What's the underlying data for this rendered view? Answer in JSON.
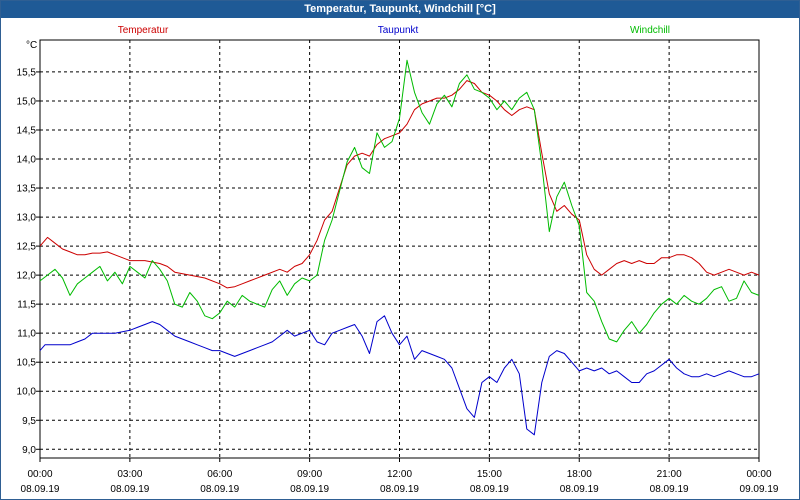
{
  "window": {
    "title": "Temperatur, Taupunkt, Windchill [°C]"
  },
  "chart_data": {
    "type": "line",
    "title": "Temperatur, Taupunkt, Windchill [°C]",
    "ylabel": "°C",
    "ylim": [
      8.85,
      16.05
    ],
    "xlim": [
      "08.09.19 00:00",
      "09.09.19 00:00"
    ],
    "grid": true,
    "legend_position": "top",
    "y_ticks": [
      "9,0",
      "9,5",
      "10,0",
      "10,5",
      "11,0",
      "11,5",
      "12,0",
      "12,5",
      "13,0",
      "13,5",
      "14,0",
      "14,5",
      "15,0",
      "15,5"
    ],
    "x_ticks": [
      {
        "time": "00:00",
        "date": "08.09.19"
      },
      {
        "time": "03:00",
        "date": "08.09.19"
      },
      {
        "time": "06:00",
        "date": "08.09.19"
      },
      {
        "time": "09:00",
        "date": "08.09.19"
      },
      {
        "time": "12:00",
        "date": "08.09.19"
      },
      {
        "time": "15:00",
        "date": "08.09.19"
      },
      {
        "time": "18:00",
        "date": "08.09.19"
      },
      {
        "time": "21:00",
        "date": "08.09.19"
      },
      {
        "time": "00:00",
        "date": "09.09.19"
      }
    ],
    "series": [
      {
        "name": "Temperatur",
        "color": "#cc0000",
        "points": [
          [
            "00:00",
            12.5
          ],
          [
            "00:15",
            12.65
          ],
          [
            "00:30",
            12.55
          ],
          [
            "00:45",
            12.45
          ],
          [
            "01:00",
            12.4
          ],
          [
            "01:15",
            12.35
          ],
          [
            "01:30",
            12.35
          ],
          [
            "01:45",
            12.38
          ],
          [
            "02:00",
            12.38
          ],
          [
            "02:15",
            12.4
          ],
          [
            "02:30",
            12.35
          ],
          [
            "02:45",
            12.3
          ],
          [
            "03:00",
            12.25
          ],
          [
            "03:30",
            12.25
          ],
          [
            "04:00",
            12.2
          ],
          [
            "04:15",
            12.15
          ],
          [
            "04:30",
            12.05
          ],
          [
            "05:00",
            12.0
          ],
          [
            "05:30",
            11.95
          ],
          [
            "06:00",
            11.85
          ],
          [
            "06:15",
            11.78
          ],
          [
            "06:30",
            11.8
          ],
          [
            "06:45",
            11.85
          ],
          [
            "07:00",
            11.9
          ],
          [
            "07:30",
            12.0
          ],
          [
            "08:00",
            12.1
          ],
          [
            "08:15",
            12.05
          ],
          [
            "08:30",
            12.15
          ],
          [
            "08:45",
            12.2
          ],
          [
            "09:00",
            12.35
          ],
          [
            "09:15",
            12.6
          ],
          [
            "09:30",
            12.95
          ],
          [
            "09:45",
            13.1
          ],
          [
            "10:00",
            13.5
          ],
          [
            "10:15",
            13.9
          ],
          [
            "10:30",
            14.05
          ],
          [
            "10:45",
            14.1
          ],
          [
            "11:00",
            14.05
          ],
          [
            "11:15",
            14.25
          ],
          [
            "11:30",
            14.35
          ],
          [
            "11:45",
            14.4
          ],
          [
            "12:00",
            14.45
          ],
          [
            "12:15",
            14.6
          ],
          [
            "12:30",
            14.85
          ],
          [
            "12:45",
            14.95
          ],
          [
            "13:00",
            15.0
          ],
          [
            "13:15",
            15.05
          ],
          [
            "13:30",
            15.05
          ],
          [
            "13:45",
            15.1
          ],
          [
            "14:00",
            15.2
          ],
          [
            "14:15",
            15.35
          ],
          [
            "14:30",
            15.3
          ],
          [
            "14:45",
            15.15
          ],
          [
            "15:00",
            15.1
          ],
          [
            "15:15",
            15.0
          ],
          [
            "15:30",
            14.85
          ],
          [
            "15:45",
            14.75
          ],
          [
            "16:00",
            14.85
          ],
          [
            "16:15",
            14.9
          ],
          [
            "16:30",
            14.85
          ],
          [
            "16:45",
            14.1
          ],
          [
            "17:00",
            13.4
          ],
          [
            "17:15",
            13.1
          ],
          [
            "17:30",
            13.2
          ],
          [
            "17:45",
            13.05
          ],
          [
            "18:00",
            12.95
          ],
          [
            "18:15",
            12.35
          ],
          [
            "18:30",
            12.1
          ],
          [
            "18:45",
            12.0
          ],
          [
            "19:00",
            12.1
          ],
          [
            "19:15",
            12.2
          ],
          [
            "19:30",
            12.25
          ],
          [
            "19:45",
            12.2
          ],
          [
            "20:00",
            12.25
          ],
          [
            "20:15",
            12.2
          ],
          [
            "20:30",
            12.2
          ],
          [
            "20:45",
            12.3
          ],
          [
            "21:00",
            12.3
          ],
          [
            "21:15",
            12.35
          ],
          [
            "21:30",
            12.35
          ],
          [
            "21:45",
            12.3
          ],
          [
            "22:00",
            12.2
          ],
          [
            "22:15",
            12.05
          ],
          [
            "22:30",
            12.0
          ],
          [
            "22:45",
            12.05
          ],
          [
            "23:00",
            12.1
          ],
          [
            "23:15",
            12.05
          ],
          [
            "23:30",
            12.0
          ],
          [
            "23:45",
            12.05
          ],
          [
            "24:00",
            12.0
          ]
        ]
      },
      {
        "name": "Taupunkt",
        "color": "#0000cc",
        "points": [
          [
            "00:00",
            10.7
          ],
          [
            "00:10",
            10.8
          ],
          [
            "00:30",
            10.8
          ],
          [
            "01:00",
            10.8
          ],
          [
            "01:15",
            10.85
          ],
          [
            "01:30",
            10.9
          ],
          [
            "01:45",
            11.0
          ],
          [
            "02:00",
            11.0
          ],
          [
            "02:30",
            11.0
          ],
          [
            "03:00",
            11.05
          ],
          [
            "03:15",
            11.1
          ],
          [
            "03:30",
            11.15
          ],
          [
            "03:45",
            11.2
          ],
          [
            "04:00",
            11.15
          ],
          [
            "04:15",
            11.05
          ],
          [
            "04:30",
            10.95
          ],
          [
            "04:45",
            10.9
          ],
          [
            "05:00",
            10.85
          ],
          [
            "05:15",
            10.8
          ],
          [
            "05:30",
            10.75
          ],
          [
            "05:45",
            10.7
          ],
          [
            "06:00",
            10.7
          ],
          [
            "06:15",
            10.65
          ],
          [
            "06:30",
            10.6
          ],
          [
            "06:45",
            10.65
          ],
          [
            "07:00",
            10.7
          ],
          [
            "07:15",
            10.75
          ],
          [
            "07:30",
            10.8
          ],
          [
            "07:45",
            10.85
          ],
          [
            "08:00",
            10.95
          ],
          [
            "08:15",
            11.05
          ],
          [
            "08:30",
            10.95
          ],
          [
            "08:45",
            11.0
          ],
          [
            "09:00",
            11.05
          ],
          [
            "09:15",
            10.85
          ],
          [
            "09:30",
            10.8
          ],
          [
            "09:45",
            11.0
          ],
          [
            "10:00",
            11.05
          ],
          [
            "10:15",
            11.1
          ],
          [
            "10:30",
            11.15
          ],
          [
            "10:45",
            10.95
          ],
          [
            "11:00",
            10.65
          ],
          [
            "11:15",
            11.2
          ],
          [
            "11:30",
            11.3
          ],
          [
            "11:45",
            11.0
          ],
          [
            "12:00",
            10.8
          ],
          [
            "12:15",
            10.95
          ],
          [
            "12:30",
            10.55
          ],
          [
            "12:45",
            10.7
          ],
          [
            "13:00",
            10.65
          ],
          [
            "13:15",
            10.6
          ],
          [
            "13:30",
            10.55
          ],
          [
            "13:45",
            10.4
          ],
          [
            "14:00",
            10.05
          ],
          [
            "14:15",
            9.7
          ],
          [
            "14:30",
            9.55
          ],
          [
            "14:45",
            10.15
          ],
          [
            "15:00",
            10.25
          ],
          [
            "15:15",
            10.15
          ],
          [
            "15:30",
            10.4
          ],
          [
            "15:45",
            10.55
          ],
          [
            "16:00",
            10.3
          ],
          [
            "16:15",
            9.35
          ],
          [
            "16:30",
            9.25
          ],
          [
            "16:45",
            10.15
          ],
          [
            "17:00",
            10.6
          ],
          [
            "17:15",
            10.7
          ],
          [
            "17:30",
            10.65
          ],
          [
            "17:45",
            10.5
          ],
          [
            "18:00",
            10.35
          ],
          [
            "18:15",
            10.4
          ],
          [
            "18:30",
            10.35
          ],
          [
            "18:45",
            10.4
          ],
          [
            "19:00",
            10.3
          ],
          [
            "19:15",
            10.35
          ],
          [
            "19:30",
            10.25
          ],
          [
            "19:45",
            10.15
          ],
          [
            "20:00",
            10.15
          ],
          [
            "20:15",
            10.3
          ],
          [
            "20:30",
            10.35
          ],
          [
            "20:45",
            10.45
          ],
          [
            "21:00",
            10.55
          ],
          [
            "21:15",
            10.4
          ],
          [
            "21:30",
            10.3
          ],
          [
            "21:45",
            10.25
          ],
          [
            "22:00",
            10.25
          ],
          [
            "22:15",
            10.3
          ],
          [
            "22:30",
            10.25
          ],
          [
            "22:45",
            10.3
          ],
          [
            "23:00",
            10.35
          ],
          [
            "23:15",
            10.3
          ],
          [
            "23:30",
            10.25
          ],
          [
            "23:45",
            10.25
          ],
          [
            "24:00",
            10.3
          ]
        ]
      },
      {
        "name": "Windchill",
        "color": "#00bb00",
        "points": [
          [
            "00:00",
            11.9
          ],
          [
            "00:15",
            12.0
          ],
          [
            "00:30",
            12.1
          ],
          [
            "00:45",
            11.95
          ],
          [
            "01:00",
            11.65
          ],
          [
            "01:15",
            11.85
          ],
          [
            "01:30",
            11.95
          ],
          [
            "01:45",
            12.05
          ],
          [
            "02:00",
            12.15
          ],
          [
            "02:15",
            11.9
          ],
          [
            "02:30",
            12.05
          ],
          [
            "02:45",
            11.85
          ],
          [
            "03:00",
            12.15
          ],
          [
            "03:15",
            12.05
          ],
          [
            "03:30",
            11.95
          ],
          [
            "03:45",
            12.25
          ],
          [
            "04:00",
            12.1
          ],
          [
            "04:15",
            11.9
          ],
          [
            "04:30",
            11.5
          ],
          [
            "04:45",
            11.45
          ],
          [
            "05:00",
            11.7
          ],
          [
            "05:15",
            11.55
          ],
          [
            "05:30",
            11.3
          ],
          [
            "05:45",
            11.25
          ],
          [
            "06:00",
            11.35
          ],
          [
            "06:15",
            11.55
          ],
          [
            "06:30",
            11.45
          ],
          [
            "06:45",
            11.65
          ],
          [
            "07:00",
            11.55
          ],
          [
            "07:15",
            11.5
          ],
          [
            "07:30",
            11.45
          ],
          [
            "07:45",
            11.75
          ],
          [
            "08:00",
            11.9
          ],
          [
            "08:15",
            11.65
          ],
          [
            "08:30",
            11.85
          ],
          [
            "08:45",
            11.95
          ],
          [
            "09:00",
            11.9
          ],
          [
            "09:15",
            12.0
          ],
          [
            "09:30",
            12.6
          ],
          [
            "09:45",
            12.95
          ],
          [
            "10:00",
            13.45
          ],
          [
            "10:15",
            13.95
          ],
          [
            "10:30",
            14.2
          ],
          [
            "10:45",
            13.85
          ],
          [
            "11:00",
            13.75
          ],
          [
            "11:15",
            14.45
          ],
          [
            "11:30",
            14.2
          ],
          [
            "11:45",
            14.3
          ],
          [
            "12:00",
            14.7
          ],
          [
            "12:15",
            15.7
          ],
          [
            "12:30",
            15.15
          ],
          [
            "12:45",
            14.8
          ],
          [
            "13:00",
            14.6
          ],
          [
            "13:15",
            14.95
          ],
          [
            "13:30",
            15.1
          ],
          [
            "13:45",
            14.9
          ],
          [
            "14:00",
            15.3
          ],
          [
            "14:15",
            15.45
          ],
          [
            "14:30",
            15.2
          ],
          [
            "14:45",
            15.15
          ],
          [
            "15:00",
            15.05
          ],
          [
            "15:15",
            14.85
          ],
          [
            "15:30",
            15.0
          ],
          [
            "15:45",
            14.85
          ],
          [
            "16:00",
            15.05
          ],
          [
            "16:15",
            15.15
          ],
          [
            "16:30",
            14.85
          ],
          [
            "16:45",
            13.9
          ],
          [
            "17:00",
            12.75
          ],
          [
            "17:15",
            13.35
          ],
          [
            "17:30",
            13.6
          ],
          [
            "17:45",
            13.2
          ],
          [
            "18:00",
            12.85
          ],
          [
            "18:15",
            11.7
          ],
          [
            "18:30",
            11.55
          ],
          [
            "18:45",
            11.2
          ],
          [
            "19:00",
            10.9
          ],
          [
            "19:15",
            10.85
          ],
          [
            "19:30",
            11.05
          ],
          [
            "19:45",
            11.2
          ],
          [
            "20:00",
            11.0
          ],
          [
            "20:15",
            11.15
          ],
          [
            "20:30",
            11.35
          ],
          [
            "20:45",
            11.5
          ],
          [
            "21:00",
            11.6
          ],
          [
            "21:15",
            11.5
          ],
          [
            "21:30",
            11.65
          ],
          [
            "21:45",
            11.55
          ],
          [
            "22:00",
            11.5
          ],
          [
            "22:15",
            11.6
          ],
          [
            "22:30",
            11.75
          ],
          [
            "22:45",
            11.8
          ],
          [
            "23:00",
            11.55
          ],
          [
            "23:15",
            11.6
          ],
          [
            "23:30",
            11.9
          ],
          [
            "23:45",
            11.7
          ],
          [
            "24:00",
            11.65
          ]
        ]
      }
    ]
  }
}
